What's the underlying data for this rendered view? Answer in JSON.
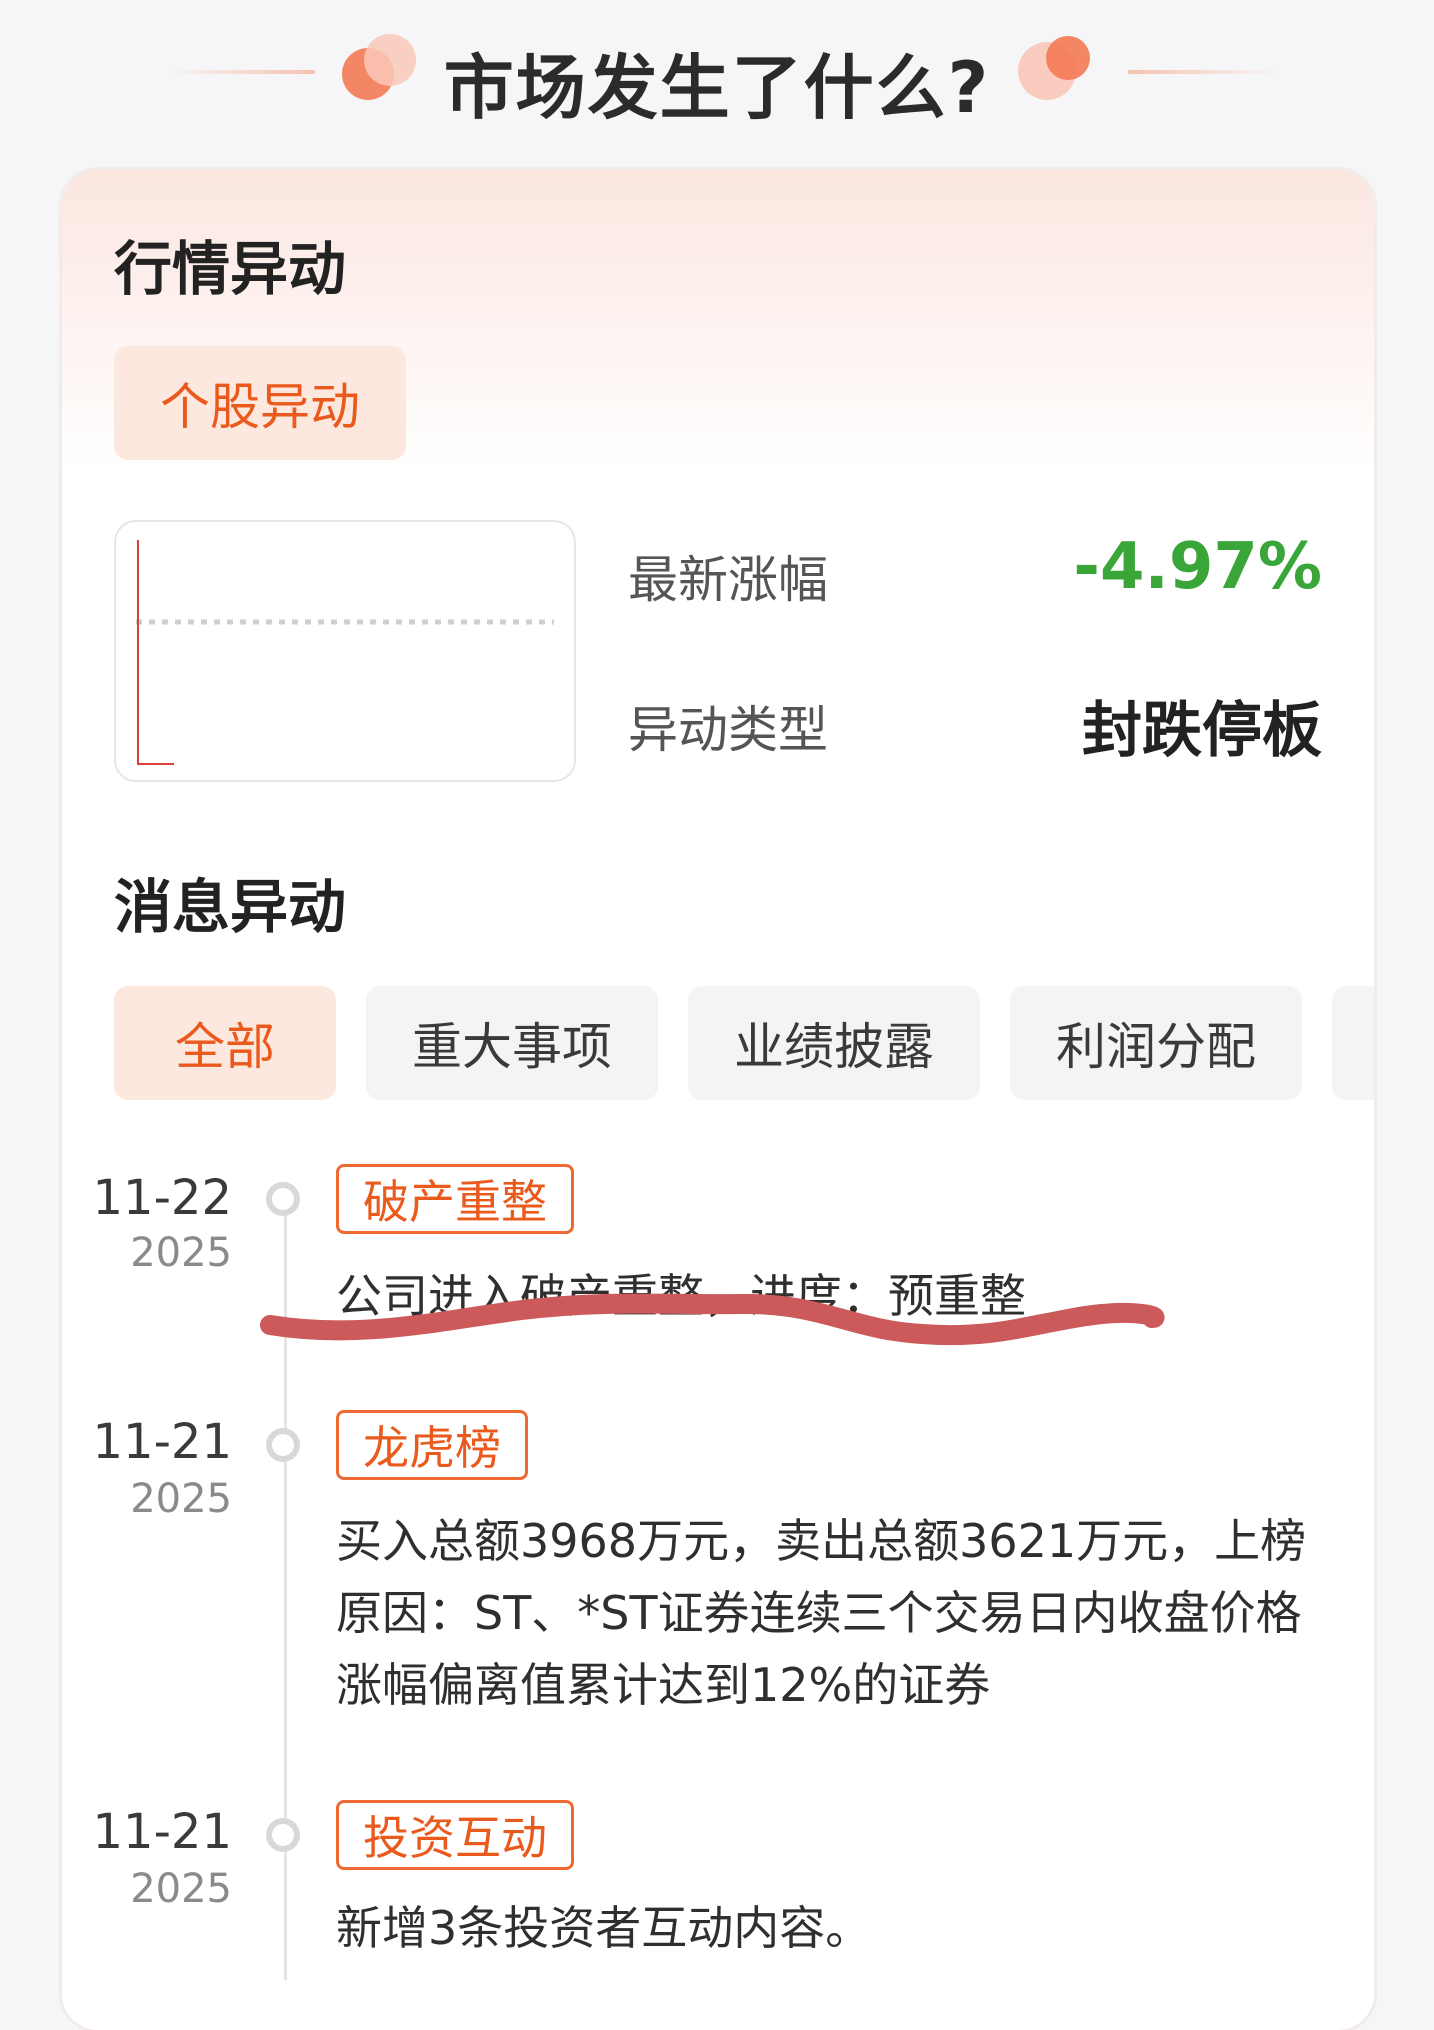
{
  "header": {
    "title": "市场发生了什么?"
  },
  "market": {
    "title": "行情异动",
    "tab": "个股异动",
    "latest_change_label": "最新涨幅",
    "latest_change_value": "-4.97%",
    "type_label": "异动类型",
    "type_value": "封跌停板",
    "colors": {
      "down": "#3aa63a",
      "accent": "#ea5a1c"
    }
  },
  "news": {
    "title": "消息异动",
    "tabs": [
      "全部",
      "重大事项",
      "业绩披露",
      "利润分配"
    ],
    "items": [
      {
        "date": "11-22",
        "year": "2025",
        "tag": "破产重整",
        "desc": [
          "公司进入破产重整，进度：预重整"
        ]
      },
      {
        "date": "11-21",
        "year": "2025",
        "tag": "龙虎榜",
        "desc": [
          "买入总额3968万元，卖出总额3621万元，上榜",
          "原因：ST、*ST证券连续三个交易日内收盘价格",
          "涨幅偏离值累计达到12%的证券"
        ]
      },
      {
        "date": "11-21",
        "year": "2025",
        "tag": "投资互动",
        "desc": [
          "新增3条投资者互动内容。"
        ]
      }
    ]
  }
}
